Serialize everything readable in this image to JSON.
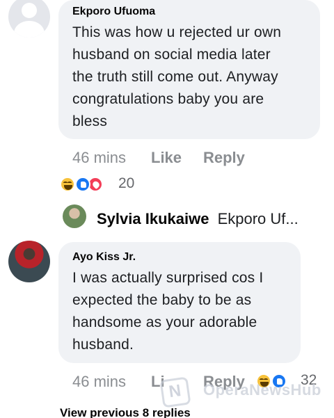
{
  "comments": [
    {
      "author": "Ekporo Ufuoma",
      "lines": [
        "This was how u rejected ur own",
        "husband on social media later",
        "the truth still come out. Anyway",
        "congratulations baby you are",
        "bless"
      ],
      "time": "46 mins",
      "like_label": "Like",
      "reply_label": "Reply",
      "reaction_count": "20"
    },
    {
      "author": "Ayo Kiss Jr.",
      "lines": [
        "I was actually surprised cos I",
        "expected the baby to be as",
        "handsome as your adorable",
        "husband."
      ],
      "time": "46 mins",
      "like_label": "Li",
      "reply_label": "Reply",
      "reaction_count": "32"
    }
  ],
  "reply_preview": {
    "name": "Sylvia Ikukaiwe",
    "text": "Ekporo Uf..."
  },
  "view_previous": "View previous 8 replies",
  "watermark": "OperaNewsHub",
  "icons": {
    "haha": "haha-reaction-icon",
    "like": "like-reaction-icon",
    "love": "love-reaction-icon"
  }
}
